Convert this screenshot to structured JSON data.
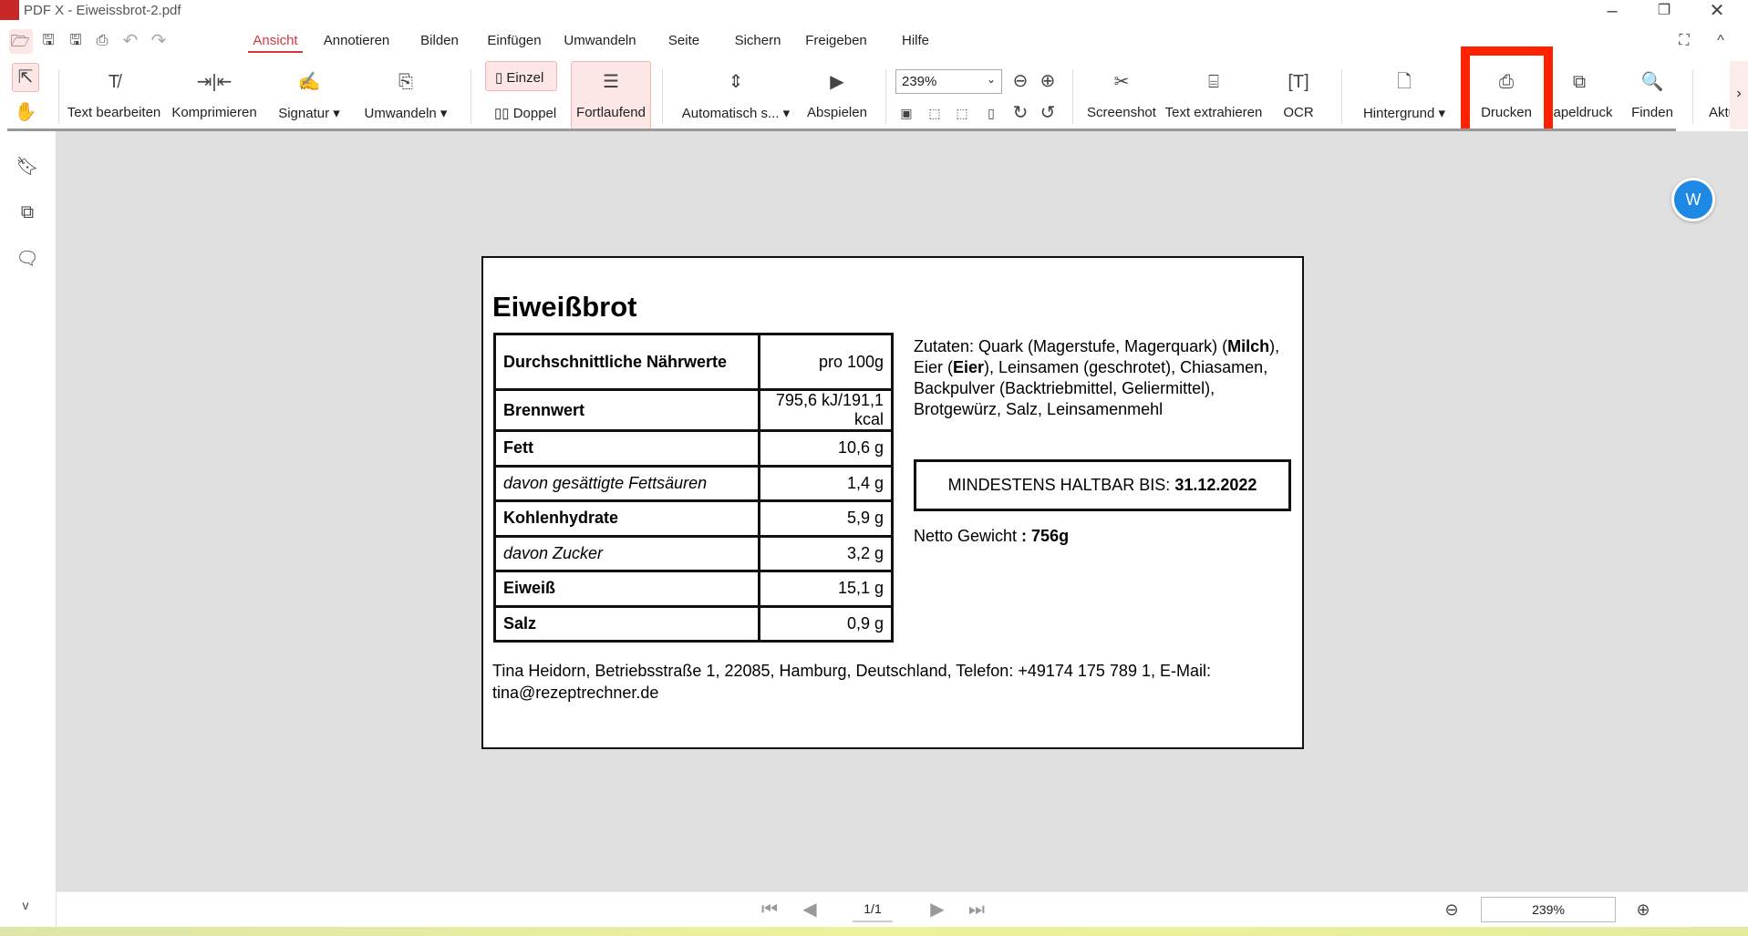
{
  "window": {
    "title": "PDF X - Eiweissbrot-2.pdf",
    "controls": [
      "minimize",
      "restore",
      "close"
    ]
  },
  "menu": {
    "tabs": [
      "Ansicht",
      "Annotieren",
      "Bilden",
      "Einfügen",
      "Umwandeln",
      "Seite",
      "Sichern",
      "Freigeben",
      "Hilfe"
    ],
    "active": "Ansicht"
  },
  "toolbar": {
    "text_edit": "Text bearbeiten",
    "compress": "Komprimieren",
    "signature": "Signatur",
    "convert": "Umwandeln",
    "single": "Einzel",
    "double": "Doppel",
    "continuous": "Fortlaufend",
    "auto_scroll": "Automatisch s...",
    "play": "Abspielen",
    "zoom": "239%",
    "screenshot": "Screenshot",
    "extract_text": "Text extrahieren",
    "ocr": "OCR",
    "background": "Hintergrund",
    "print": "Drucken",
    "batch_print": "apeldruck",
    "find": "Finden",
    "update": "Aktu"
  },
  "colors": {
    "accent": "#d9363e",
    "highlight": "#ff2200",
    "blue": "#1e88e5",
    "canvas": "#e0e0e0"
  },
  "document": {
    "title": "Eiweißbrot",
    "table": {
      "header": [
        "Durchschnittliche Nährwerte",
        "pro 100g"
      ],
      "rows": [
        [
          "Brennwert",
          "795,6 kJ/191,1 kcal"
        ],
        [
          "Fett",
          "10,6 g"
        ],
        [
          "davon gesättigte Fettsäuren",
          "1,4 g"
        ],
        [
          "Kohlenhydrate",
          "5,9 g"
        ],
        [
          "davon Zucker",
          "3,2 g"
        ],
        [
          "Eiweiß",
          "15,1 g"
        ],
        [
          "Salz",
          "0,9 g"
        ]
      ]
    },
    "ingredients": {
      "p1": "Zutaten: Quark (Magerstufe, Magerquark) (",
      "milch": "Milch",
      "p2": "), Eier (",
      "eier": "Eier",
      "p3": "), Leinsamen (geschrotet), Chiasamen, Backpulver (Backtriebmittel, Geliermittel), Brotgewürz, Salz, Leinsamenmehl"
    },
    "best_before_label": "MINDESTENS HALTBAR BIS: ",
    "best_before_date": "31.12.2022",
    "net_label": "Netto Gewicht ",
    "net_value": ": 756g",
    "footer": "Tina Heidorn, Betriebsstraße 1, 22085, Hamburg, Deutschland, Telefon: +49174 175 789 1, E-Mail: tina@rezeptrechner.de"
  },
  "statusbar": {
    "page": "1/1",
    "zoom": "239%"
  }
}
